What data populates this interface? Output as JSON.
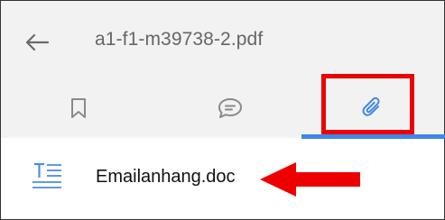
{
  "header": {
    "back_icon": "arrow-left-icon",
    "title": "a1-f1-m39738-2.pdf"
  },
  "tabs": [
    {
      "icon": "bookmark-icon",
      "active": false
    },
    {
      "icon": "comment-icon",
      "active": false
    },
    {
      "icon": "paperclip-icon",
      "active": true
    }
  ],
  "attachments": [
    {
      "icon": "document-icon",
      "name": "Emailanhang.doc"
    }
  ],
  "annotations": {
    "highlight_color": "#ee0000",
    "arrow_color": "#ee0000"
  },
  "colors": {
    "accent": "#3f86e8",
    "header_bg": "#f2f2f2",
    "icon_gray": "#8a8a8a"
  }
}
